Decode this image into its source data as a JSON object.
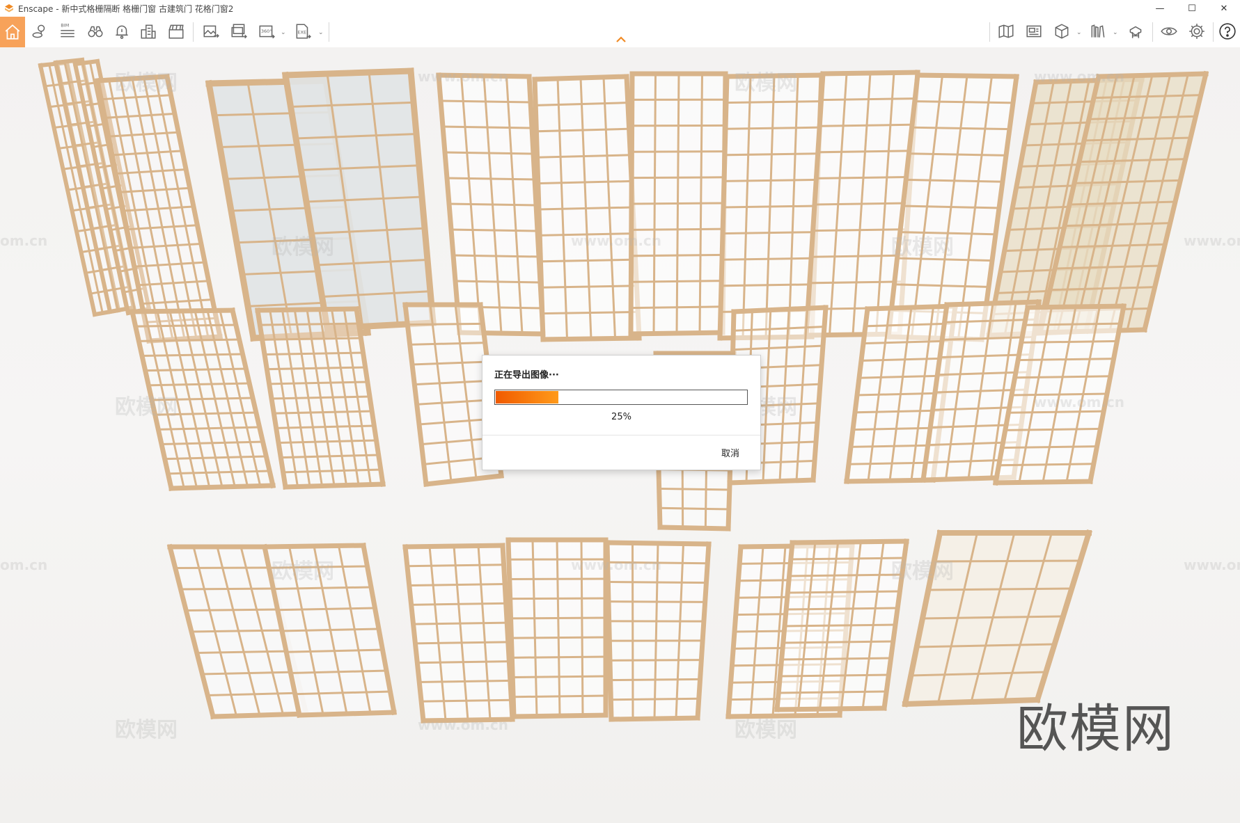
{
  "window": {
    "app_name": "Enscape",
    "title": "Enscape - 新中式格栅隔断 格栅门窗 古建筑门 花格门窗2",
    "controls": {
      "minimize": "—",
      "maximize": "☐",
      "close": "✕"
    }
  },
  "toolbar": {
    "bim_label": "BIM",
    "left_tools": [
      {
        "name": "home-icon",
        "active": true
      },
      {
        "name": "location-icon"
      },
      {
        "name": "bim-icon"
      },
      {
        "name": "binoculars-icon"
      },
      {
        "name": "bell-icon"
      },
      {
        "name": "buildings-icon"
      },
      {
        "name": "clapperboard-icon"
      },
      {
        "name": "export-image-icon"
      },
      {
        "name": "batch-export-icon"
      },
      {
        "name": "panorama-export-icon",
        "label": "360°"
      },
      {
        "name": "exe-export-icon",
        "label": "EXE"
      }
    ],
    "right_tools": [
      {
        "name": "map-icon"
      },
      {
        "name": "slideshow-icon"
      },
      {
        "name": "cube-icon"
      },
      {
        "name": "books-icon"
      },
      {
        "name": "asset-library-icon"
      },
      {
        "name": "eye-icon"
      },
      {
        "name": "gear-icon"
      },
      {
        "name": "help-icon"
      }
    ]
  },
  "colors": {
    "accent": "#f7a25a",
    "progress_start": "#f05a00",
    "progress_end": "#ff9a1a",
    "wood": "#d8b48a",
    "wood_dark": "#b38b5f",
    "paper": "#f4efe6",
    "bg": "#f4f3f2"
  },
  "watermarks": {
    "site": "www.om.cn",
    "site_short": "om.cn",
    "brand": "欧模网"
  },
  "dialog": {
    "title": "正在导出图像···",
    "progress": 0.25,
    "progress_text": "25%",
    "cancel_label": "取消"
  }
}
